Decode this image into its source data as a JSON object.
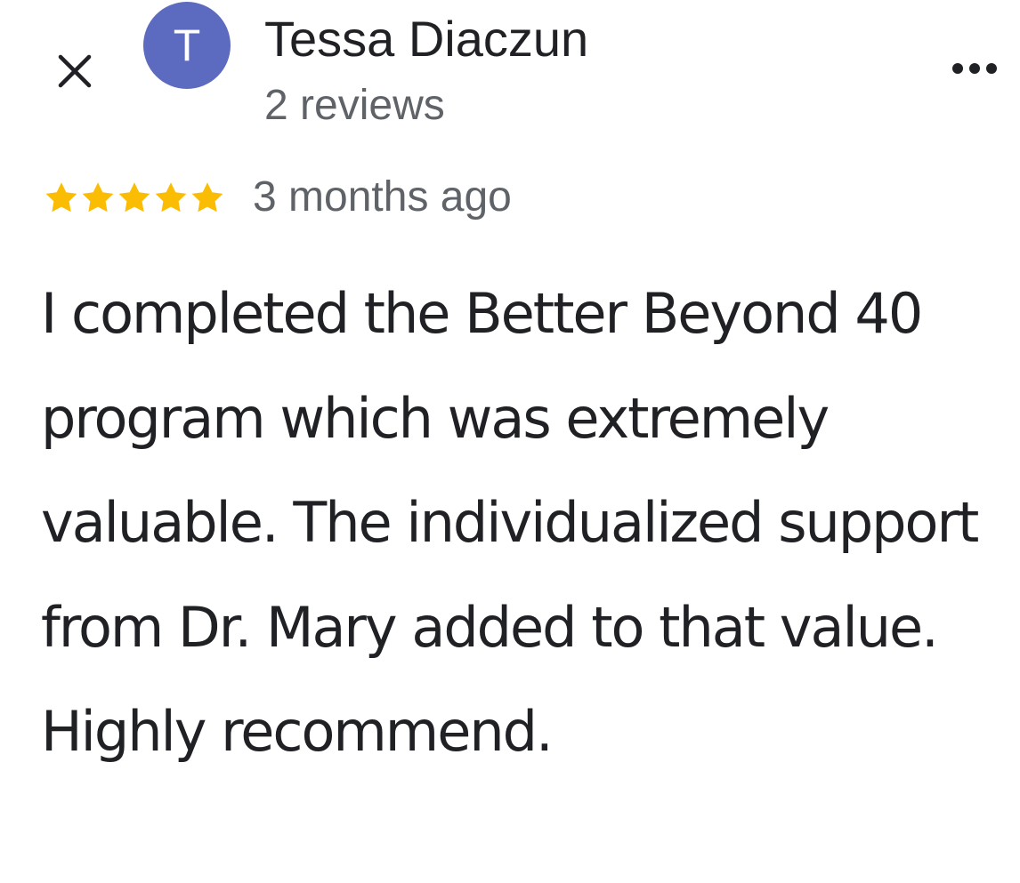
{
  "header": {
    "close_icon": "close-icon",
    "avatar_initial": "T",
    "avatar_color": "#5c6bc0",
    "reviewer_name": "Tessa Diaczun",
    "review_count": "2 reviews",
    "more_icon": "more-horizontal-icon"
  },
  "review": {
    "rating": 5,
    "max_rating": 5,
    "star_color": "#fbbc04",
    "time_ago": "3 months ago",
    "text": "I completed the Better Beyond 40 program which was extremely valuable. The individualized support from Dr. Mary added to that value. Highly recommend."
  }
}
